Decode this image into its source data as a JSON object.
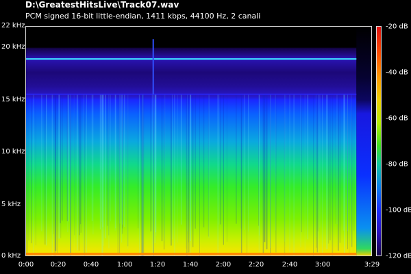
{
  "window": {
    "title": "D:\\GreatestHitsLive\\Track07.wav",
    "subtitle": "PCM signed 16-bit little-endian, 1411 kbps, 44100 Hz, 2 canali"
  },
  "chart_data": {
    "type": "heatmap",
    "title": "D:\\GreatestHitsLive\\Track07.wav",
    "subtitle": "PCM signed 16-bit little-endian, 1411 kbps, 44100 Hz, 2 canali",
    "x_axis": {
      "ticks": [
        "0:00",
        "0:20",
        "0:40",
        "1:00",
        "1:20",
        "1:40",
        "2:00",
        "2:20",
        "2:40",
        "3:00",
        "3:29"
      ],
      "range_seconds": [
        0,
        209
      ]
    },
    "y_axis": {
      "ticks": [
        "0 kHz",
        "5 kHz",
        "10 kHz",
        "15 kHz",
        "20 kHz",
        "22 kHz"
      ],
      "range_khz": [
        0,
        22
      ]
    },
    "colorbar": {
      "ticks": [
        "-20 dB",
        "-40 dB",
        "-60 dB",
        "-80 dB",
        "-100 dB",
        "-120 dB"
      ],
      "range_db": [
        -120,
        -20
      ]
    },
    "features": {
      "lowpass_cutoff_khz": 15.5,
      "spike_line_khz": 18.9,
      "signal_end_seconds": 200,
      "transient_seconds": 77
    }
  }
}
